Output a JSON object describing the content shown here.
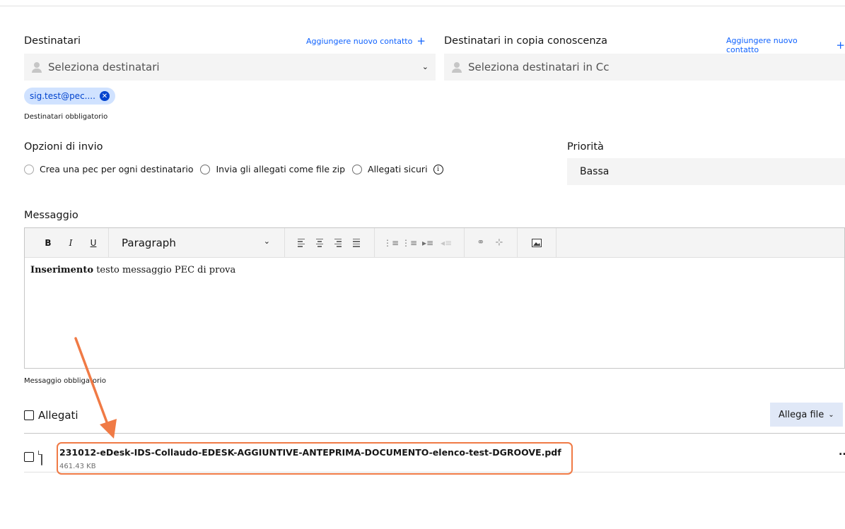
{
  "recipients": {
    "label": "Destinatari",
    "add_contact": "Aggiungere nuovo contatto",
    "placeholder": "Seleziona destinatari",
    "tags": [
      "sig.test@pec...."
    ],
    "helper": "Destinatari obbligatorio"
  },
  "cc": {
    "label": "Destinatari in copia conoscenza",
    "add_contact": "Aggiungere nuovo contatto",
    "placeholder": "Seleziona destinatari in Cc"
  },
  "send_options": {
    "label": "Opzioni di invio",
    "options": [
      "Crea una pec per ogni destinatario",
      "Invia gli allegati come file zip",
      "Allegati sicuri"
    ]
  },
  "priority": {
    "label": "Priorità",
    "value": "Bassa"
  },
  "message": {
    "label": "Messaggio",
    "toolbar": {
      "bold": "B",
      "italic": "I",
      "underline": "U",
      "format": "Paragraph"
    },
    "body_bold": "Inserimento",
    "body_rest": " testo messaggio PEC di prova",
    "helper": "Messaggio obbligatorio"
  },
  "attachments": {
    "label": "Allegati",
    "attach_button": "Allega file",
    "files": [
      {
        "name": "231012-eDesk-IDS-Collaudo-EDESK-AGGIUNTIVE-ANTEPRIMA-DOCUMENTO-elenco-test-DGROOVE.pdf",
        "size": "461.43 KB"
      }
    ],
    "more": "..."
  },
  "colors": {
    "link": "#0f62fe",
    "tag_bg": "#d0e2ff",
    "annotation": "#f07a45",
    "field_bg": "#f4f4f4"
  }
}
